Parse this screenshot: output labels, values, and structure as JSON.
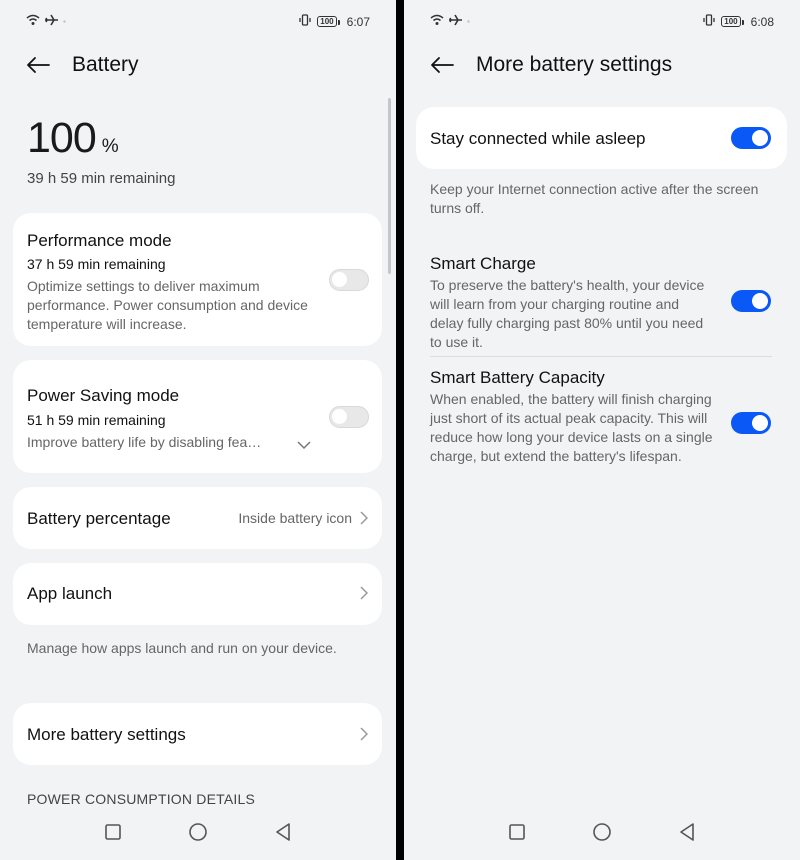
{
  "left": {
    "status": {
      "time": "6:07",
      "battery": "100"
    },
    "header": {
      "title": "Battery"
    },
    "battery_level": {
      "value": "100",
      "unit": "%",
      "remaining": "39 h 59 min remaining"
    },
    "performance_mode": {
      "title": "Performance mode",
      "remaining": "37 h 59 min remaining",
      "description": "Optimize settings to deliver maximum performance. Power consumption and device temperature will increase.",
      "enabled": false
    },
    "power_saving_mode": {
      "title": "Power Saving mode",
      "remaining": "51 h 59 min remaining",
      "description": "Improve battery life by disabling fea…",
      "enabled": false
    },
    "battery_percentage": {
      "label": "Battery percentage",
      "value": "Inside battery icon"
    },
    "app_launch": {
      "label": "App launch",
      "caption": "Manage how apps launch and run on your device."
    },
    "more_settings": {
      "label": "More battery settings"
    },
    "power_details": {
      "header": "POWER CONSUMPTION DETAILS"
    }
  },
  "right": {
    "status": {
      "time": "6:08",
      "battery": "100"
    },
    "header": {
      "title": "More battery settings"
    },
    "stay_connected": {
      "label": "Stay connected while asleep",
      "caption": "Keep your Internet connection active after the screen turns off.",
      "enabled": true
    },
    "smart_charge": {
      "title": "Smart Charge",
      "description": "To preserve the battery's health, your device will learn from your charging routine and delay fully charging past 80% until you need to use it.",
      "enabled": true
    },
    "smart_capacity": {
      "title": "Smart Battery Capacity",
      "description": "When enabled, the battery will finish charging just short of its actual peak capacity. This will reduce how long your device lasts on a single charge, but extend the battery's lifespan.",
      "enabled": true
    }
  },
  "colors": {
    "accent": "#0a59f7",
    "background": "#f1f3f5",
    "card": "#ffffff"
  }
}
